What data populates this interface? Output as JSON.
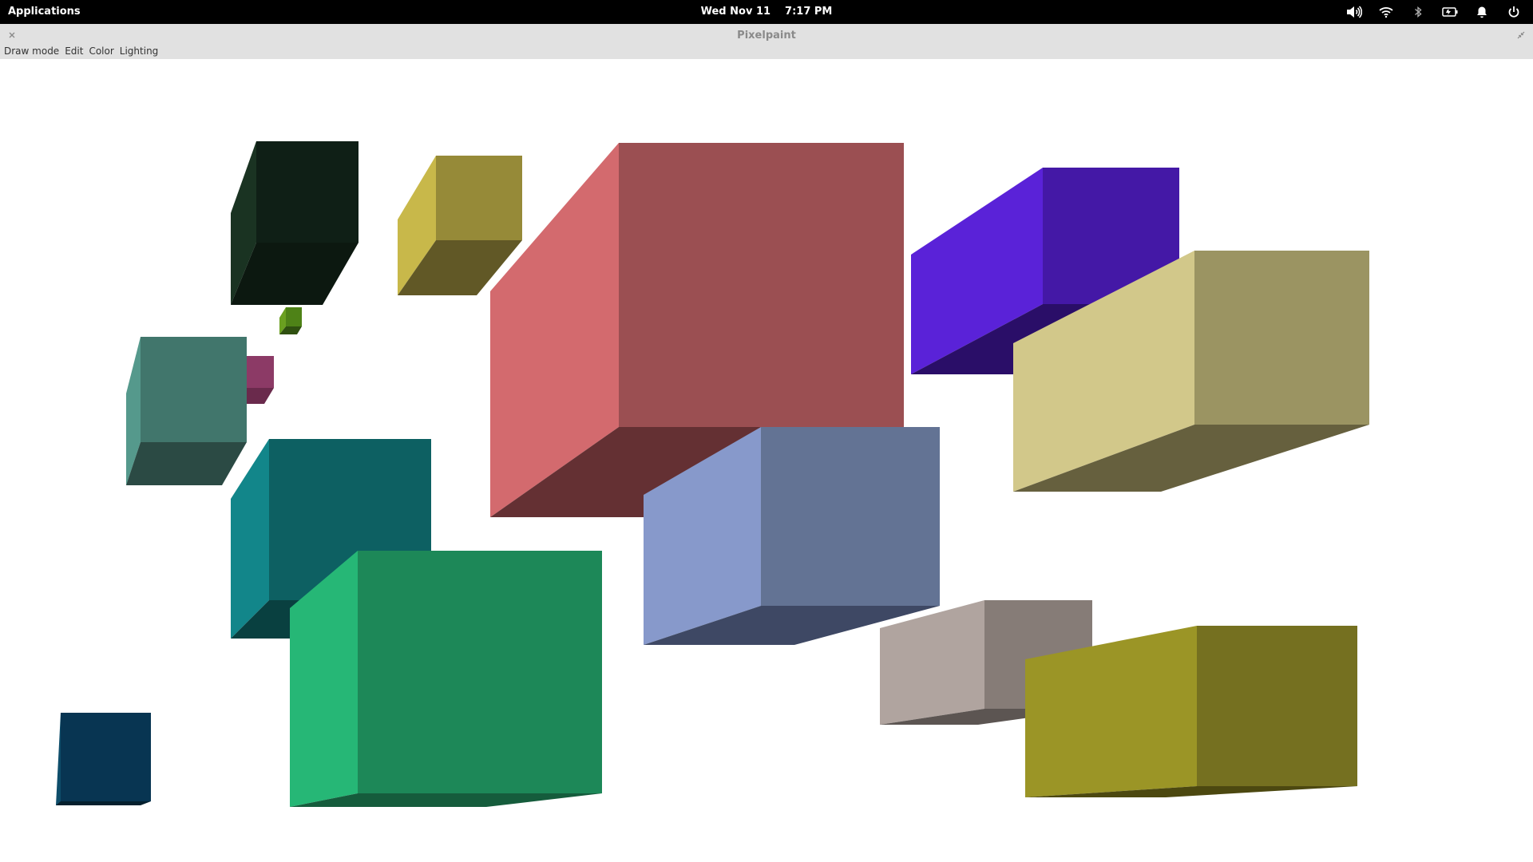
{
  "panel": {
    "applications_label": "Applications",
    "date": "Wed Nov 11",
    "time": "7:17 PM",
    "tray_icons": [
      "volume-icon",
      "wifi-icon",
      "bluetooth-icon",
      "battery-icon",
      "notification-bell-icon",
      "power-icon"
    ]
  },
  "window": {
    "title": "Pixelpaint",
    "close_glyph": "×"
  },
  "menu": {
    "items": [
      "Draw mode",
      "Edit",
      "Color",
      "Lighting"
    ]
  },
  "cubes": [
    {
      "name": "cube-small-blue-green",
      "colors": {
        "side": "#0e4d6a",
        "front": "#083552",
        "bottom": "#05202e"
      }
    },
    {
      "name": "cube-dark-green",
      "colors": {
        "side": "#1a3322",
        "front": "#0f1f16",
        "bottom": "#0c1810"
      }
    },
    {
      "name": "cube-olive-yellow",
      "colors": {
        "side": "#c8b84a",
        "front": "#968a38",
        "bottom": "#615826"
      }
    },
    {
      "name": "cube-tiny-green",
      "colors": {
        "side": "#6aa020",
        "front": "#4e8217",
        "bottom": "#2f5010"
      }
    },
    {
      "name": "cube-tiny-magenta",
      "colors": {
        "side": "#a84b80",
        "front": "#8c3a66",
        "bottom": "#6a2a4c"
      }
    },
    {
      "name": "cube-slate-teal",
      "colors": {
        "side": "#55998c",
        "front": "#41766c",
        "bottom": "#2b4a44"
      }
    },
    {
      "name": "cube-teal",
      "colors": {
        "side": "#12868a",
        "front": "#0d6062",
        "bottom": "#094040"
      }
    },
    {
      "name": "cube-rose",
      "colors": {
        "side": "#d36a6e",
        "front": "#9b4f52",
        "bottom": "#643033"
      }
    },
    {
      "name": "cube-emerald",
      "colors": {
        "side": "#26b776",
        "front": "#1d8858",
        "bottom": "#155c3c"
      }
    },
    {
      "name": "cube-periwinkle",
      "colors": {
        "side": "#8799cb",
        "front": "#637394",
        "bottom": "#3e4864"
      }
    },
    {
      "name": "cube-violet",
      "colors": {
        "side": "#5a22d8",
        "front": "#4418a6",
        "bottom": "#2a0e68"
      }
    },
    {
      "name": "cube-khaki",
      "colors": {
        "side": "#d2c88a",
        "front": "#9b9462",
        "bottom": "#66603e"
      }
    },
    {
      "name": "cube-taupe",
      "colors": {
        "side": "#b0a49f",
        "front": "#867c77",
        "bottom": "#5c5552"
      }
    },
    {
      "name": "cube-olive",
      "colors": {
        "side": "#9b9526",
        "front": "#757020",
        "bottom": "#4c4810"
      }
    }
  ]
}
